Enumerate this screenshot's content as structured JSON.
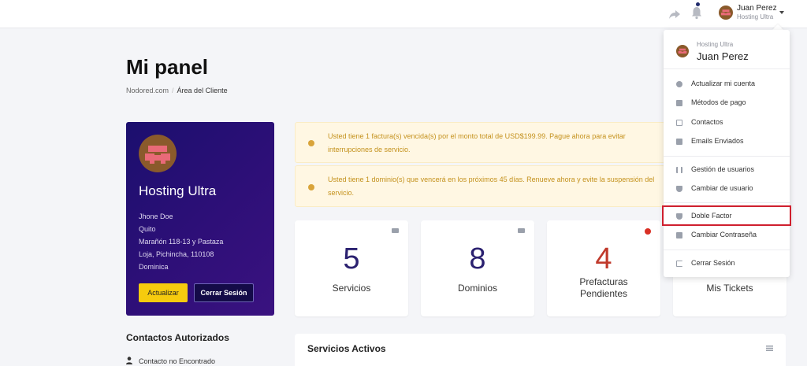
{
  "header": {
    "user_name": "Juan Perez",
    "user_company": "Hosting Ultra",
    "icons": [
      "share-icon",
      "bell-icon",
      "avatar",
      "chevron-down-icon"
    ]
  },
  "page": {
    "title": "Mi panel",
    "breadcrumb": [
      "Nodored.com",
      "Área del Cliente"
    ]
  },
  "profile": {
    "company": "Hosting Ultra",
    "lines": [
      "Jhone Doe",
      "Quito",
      "Marañón 118-13 y Pastaza",
      "Loja, Pichincha, 110108",
      "Dominica"
    ],
    "update_button": "Actualizar",
    "logout_button": "Cerrar Sesión"
  },
  "alerts": [
    {
      "text": "Usted tiene 1 factura(s) vencida(s) por el monto total de USD$199.99. Pague ahora para evitar interrupciones de servicio."
    },
    {
      "text": "Usted tiene 1 dominio(s) que vencerá en los próximos 45 días. Renueve ahora y evite la suspensión del servicio."
    }
  ],
  "stats": [
    {
      "value": "5",
      "label": "Servicios",
      "icon": "server-icon"
    },
    {
      "value": "8",
      "label": "Dominios",
      "icon": "globe-icon"
    },
    {
      "value": "4",
      "label": "Prefacturas Pendientes",
      "icon": "alert-icon",
      "color": "#c0392b"
    },
    {
      "value": "",
      "label": "Mis Tickets",
      "icon": "ticket-icon"
    }
  ],
  "contacts": {
    "title": "Contactos Autorizados",
    "empty": "Contacto no Encontrado"
  },
  "services_panel": {
    "title": "Servicios Activos"
  },
  "dropdown": {
    "company": "Hosting Ultra",
    "user": "Juan Perez",
    "groups": [
      [
        "Actualizar mi cuenta",
        "Métodos de pago",
        "Contactos",
        "Emails Enviados"
      ],
      [
        "Gestión de usuarios",
        "Cambiar de usuario"
      ],
      [
        "Doble Factor",
        "Cambiar Contraseña"
      ],
      [
        "Cerrar Sesión"
      ]
    ],
    "highlighted": "Doble Factor"
  },
  "colors": {
    "brand_purple": "#2e0f78",
    "accent_yellow": "#f6cb0e",
    "alert_text": "#c4911c",
    "highlight_red": "#cf1f2e"
  }
}
